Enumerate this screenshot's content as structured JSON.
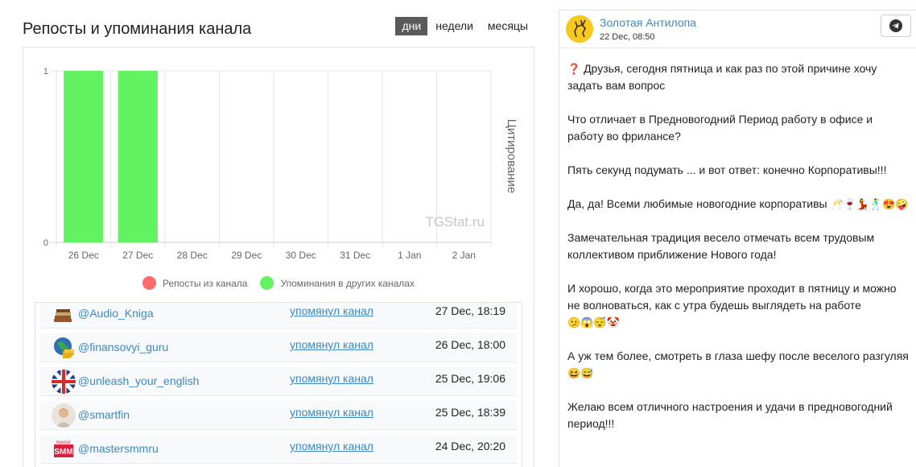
{
  "header": {
    "title": "Репосты и упоминания канала",
    "periods": [
      {
        "label": "дни",
        "active": true
      },
      {
        "label": "недели",
        "active": false
      },
      {
        "label": "месяцы",
        "active": false
      }
    ]
  },
  "chart_data": {
    "type": "bar",
    "categories": [
      "26 Dec",
      "27 Dec",
      "28 Dec",
      "29 Dec",
      "30 Dec",
      "31 Dec",
      "1 Jan",
      "2 Jan"
    ],
    "series": [
      {
        "name": "Репосты из канала",
        "color": "#ff6b6b",
        "values": [
          0,
          0,
          0,
          0,
          0,
          0,
          0,
          0
        ]
      },
      {
        "name": "Упоминания в других каналах",
        "color": "#62f262",
        "values": [
          1,
          1,
          0,
          0,
          0,
          0,
          0,
          0
        ]
      }
    ],
    "ylabel": "Цитирование",
    "ylim": [
      0,
      1
    ],
    "yticks": [
      "0",
      "1"
    ],
    "watermark": "TGStat.ru",
    "grid": true,
    "legend": "bottom"
  },
  "mentions": [
    {
      "channel": "@Audio_Kniga",
      "action": "упомянул канал",
      "time": "27 Dec, 18:19",
      "avatar": "books-icon"
    },
    {
      "channel": "@finansovyi_guru",
      "action": "упомянул канал",
      "time": "26 Dec, 18:00",
      "avatar": "globe-money-icon"
    },
    {
      "channel": "@unleash_your_english",
      "action": "упомянул канал",
      "time": "25 Dec, 19:06",
      "avatar": "uk-flag-icon"
    },
    {
      "channel": "@smartfin",
      "action": "упомянул канал",
      "time": "25 Dec, 18:39",
      "avatar": "person-avatar-icon"
    },
    {
      "channel": "@mastersmmru",
      "action": "упомянул канал",
      "time": "24 Dec, 20:20",
      "avatar": "master-smm-logo"
    }
  ],
  "post": {
    "channel_name": "Золотая Антилопа",
    "date": "22 Dec, 08:50",
    "logo_icon": "antelope-logo",
    "paragraphs": [
      {
        "emoji_before": "❓",
        "text": " Друзья, сегодня пятница и как раз по этой причине хочу задать вам вопрос",
        "emoji_after": ""
      },
      {
        "emoji_before": "",
        "text": "Что отличает в Предновогодний Период работу в офисе и работу во фрилансе?",
        "emoji_after": ""
      },
      {
        "emoji_before": "",
        "text": "Пять секунд подумать ... и вот ответ: конечно Корпоративы!!!",
        "emoji_after": ""
      },
      {
        "emoji_before": "",
        "text": "Да, да! Всеми любимые новогодние корпоративы ",
        "emoji_after": "🥂🍷💃🕺😍🤪"
      },
      {
        "emoji_before": "",
        "text": "Замечательная традиция весело отмечать всем трудовым коллективом приближение Нового года!",
        "emoji_after": ""
      },
      {
        "emoji_before": "",
        "text": "И хорошо, когда это мероприятие проходит в пятницу и можно не волноваться, как с утра будешь выглядеть на работе ",
        "emoji_after": "🫤😱😴🤡"
      },
      {
        "emoji_before": "",
        "text": "А уж тем более, смотреть в глаза шефу после веселого разгуляя ",
        "emoji_after": "😆😅"
      },
      {
        "emoji_before": "",
        "text": "Желаю всем отличного настроения и удачи в предновогодний период!!!",
        "emoji_after": ""
      }
    ]
  }
}
